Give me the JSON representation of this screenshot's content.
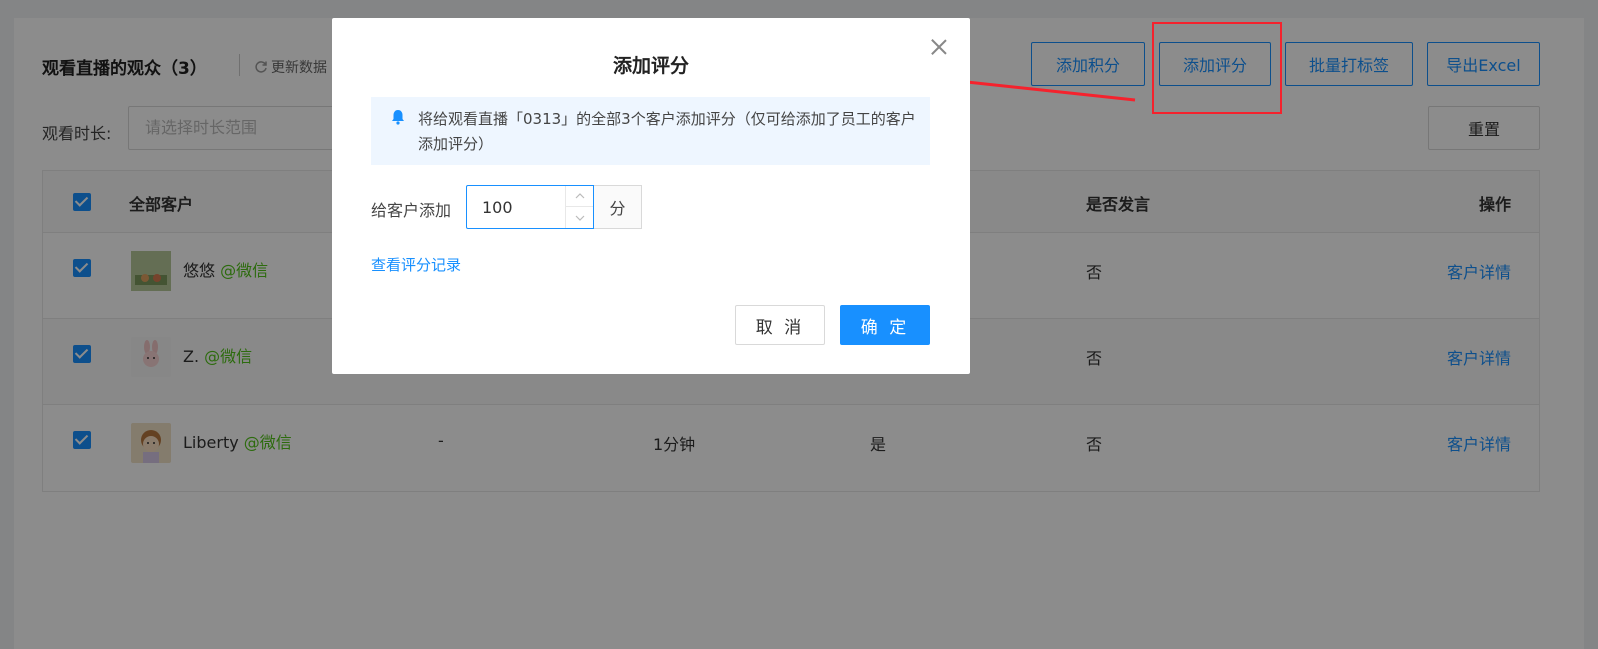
{
  "header": {
    "title": "观看直播的观众（3）",
    "refresh_label": "更新数据"
  },
  "toolbar": {
    "add_points_label": "添加积分",
    "add_score_label": "添加评分",
    "batch_tag_label": "批量打标签",
    "export_label": "导出Excel"
  },
  "filter": {
    "duration_label": "观看时长:",
    "duration_placeholder": "请选择时长范围",
    "reset_label": "重置"
  },
  "table": {
    "columns": {
      "customer": "全部客户",
      "spoke": "是否发言",
      "action": "操作"
    },
    "rows": [
      {
        "name": "悠悠",
        "source": "@微信",
        "col2": "",
        "duration": "",
        "flag": "",
        "spoke": "否",
        "action": "客户详情"
      },
      {
        "name": "Z.",
        "source": "@微信",
        "col2": "",
        "duration": "",
        "flag": "",
        "spoke": "否",
        "action": "客户详情"
      },
      {
        "name": "Liberty",
        "source": "@微信",
        "col2": "-",
        "duration": "1分钟",
        "flag": "是",
        "spoke": "否",
        "action": "客户详情"
      }
    ]
  },
  "modal": {
    "title": "添加评分",
    "notice": "将给观看直播「0313」的全部3个客户添加评分（仅可给添加了员工的客户添加评分）",
    "score_label": "给客户添加",
    "score_value": "100",
    "unit": "分",
    "view_records_link": "查看评分记录",
    "cancel_label": "取 消",
    "confirm_label": "确 定"
  },
  "colors": {
    "primary": "#1890ff",
    "wechat_green": "#52c41a",
    "annotation_red": "#f5222d"
  }
}
